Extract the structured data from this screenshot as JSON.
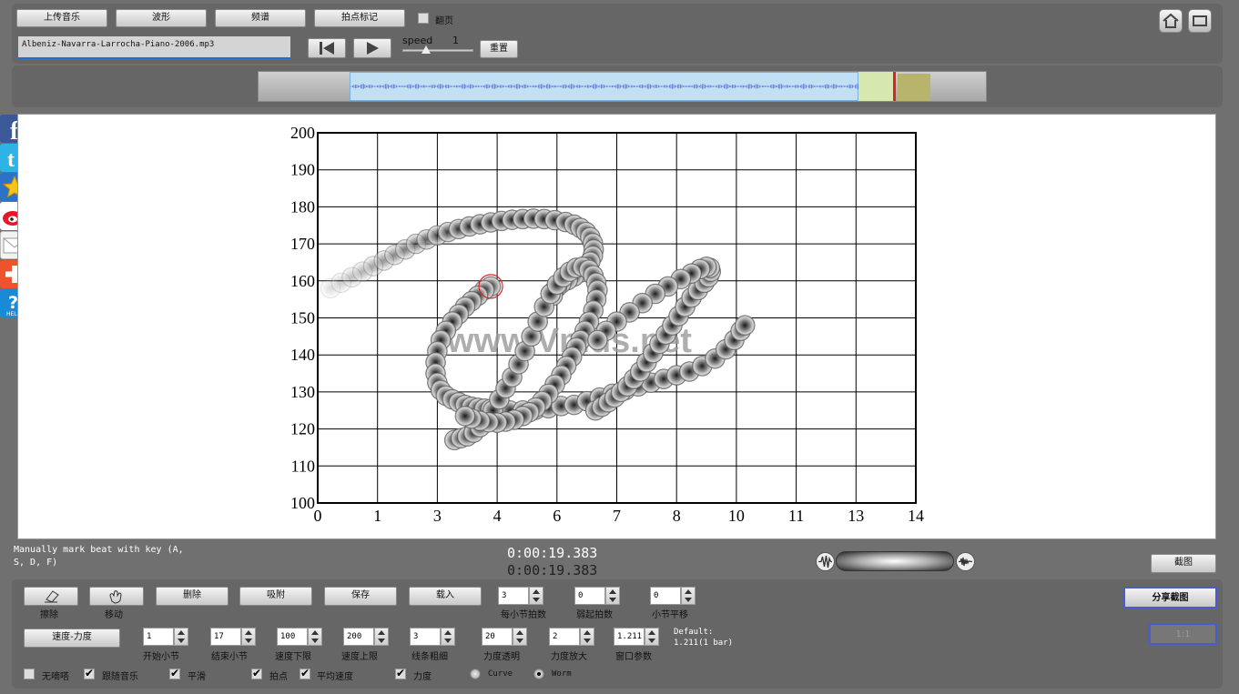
{
  "toolbar": {
    "upload_label": "上传音乐",
    "waveform_label": "波形",
    "spectrum_label": "频谱",
    "beat_mark_label": "拍点标记",
    "flip_label": "翻页",
    "flip_checked": false,
    "filename": "Albeniz-Navarra-Larrocha-Piano-2006.mp3",
    "speed_label": "speed",
    "speed_value": "1",
    "speed_fraction": 0.32,
    "reset_label": "重置"
  },
  "timeline": {
    "view_start_fraction": 0.125,
    "view_end_fraction": 0.825,
    "playhead_fraction": 0.873
  },
  "chart_data": {
    "type": "scatter",
    "title": "",
    "xlabel": "",
    "ylabel": "",
    "xlim": [
      0,
      14
    ],
    "ylim": [
      100,
      200
    ],
    "x_ticks": [
      0,
      1,
      3,
      4,
      6,
      7,
      8,
      10,
      11,
      13,
      14
    ],
    "y_ticks": [
      100,
      110,
      120,
      130,
      140,
      150,
      160,
      170,
      180,
      190,
      200
    ],
    "grid": true,
    "watermark": "www.Vmus.net",
    "highlighted_point": [
      4.05,
      158.5
    ],
    "points": [
      [
        0.3,
        158
      ],
      [
        0.55,
        159.5
      ],
      [
        0.8,
        161
      ],
      [
        1.05,
        162.5
      ],
      [
        1.3,
        164
      ],
      [
        1.55,
        165.5
      ],
      [
        1.8,
        167
      ],
      [
        2.05,
        168.5
      ],
      [
        2.3,
        170
      ],
      [
        2.55,
        171.2
      ],
      [
        2.8,
        172.3
      ],
      [
        3.05,
        173.2
      ],
      [
        3.3,
        174
      ],
      [
        3.55,
        174.7
      ],
      [
        3.8,
        175.3
      ],
      [
        4.05,
        175.8
      ],
      [
        4.3,
        176.2
      ],
      [
        4.55,
        176.5
      ],
      [
        4.8,
        176.7
      ],
      [
        5.05,
        176.8
      ],
      [
        5.3,
        176.7
      ],
      [
        5.55,
        176.4
      ],
      [
        5.8,
        175.9
      ],
      [
        6.0,
        175.2
      ],
      [
        6.15,
        174.3
      ],
      [
        6.28,
        173.2
      ],
      [
        6.38,
        171.8
      ],
      [
        6.44,
        170.2
      ],
      [
        6.46,
        168.5
      ],
      [
        6.44,
        166.8
      ],
      [
        6.38,
        165.2
      ],
      [
        6.28,
        163.7
      ],
      [
        6.16,
        162.3
      ],
      [
        6.0,
        161.2
      ],
      [
        5.85,
        160.2
      ],
      [
        5.7,
        159.3
      ],
      [
        5.6,
        158.3
      ],
      [
        5.52,
        157.2
      ],
      [
        5.5,
        156
      ],
      [
        4.05,
        158.5
      ],
      [
        3.9,
        157.5
      ],
      [
        3.75,
        156
      ],
      [
        3.6,
        154.5
      ],
      [
        3.45,
        153
      ],
      [
        3.3,
        151
      ],
      [
        3.15,
        149
      ],
      [
        3.0,
        146.5
      ],
      [
        2.88,
        144
      ],
      [
        2.8,
        141
      ],
      [
        2.76,
        138
      ],
      [
        2.76,
        135
      ],
      [
        2.8,
        132.5
      ],
      [
        2.88,
        130.5
      ],
      [
        3.0,
        129
      ],
      [
        3.15,
        128
      ],
      [
        3.3,
        127.2
      ],
      [
        3.45,
        126.5
      ],
      [
        3.6,
        126
      ],
      [
        3.75,
        125.7
      ],
      [
        3.9,
        125.5
      ],
      [
        4.05,
        125.4
      ],
      [
        4.2,
        125.2
      ],
      [
        4.5,
        125
      ],
      [
        4.8,
        125
      ],
      [
        5.1,
        125.2
      ],
      [
        5.4,
        125.6
      ],
      [
        5.7,
        126.2
      ],
      [
        3.2,
        117
      ],
      [
        3.35,
        117.5
      ],
      [
        3.5,
        118
      ],
      [
        3.65,
        119
      ],
      [
        3.8,
        120.5
      ],
      [
        3.95,
        122.5
      ],
      [
        4.1,
        125
      ],
      [
        4.25,
        128
      ],
      [
        4.4,
        131
      ],
      [
        4.55,
        134
      ],
      [
        4.7,
        137.5
      ],
      [
        4.85,
        141
      ],
      [
        5.0,
        145
      ],
      [
        5.15,
        149
      ],
      [
        5.3,
        153
      ],
      [
        5.45,
        156.5
      ],
      [
        5.6,
        159
      ],
      [
        5.75,
        161
      ],
      [
        5.9,
        162.5
      ],
      [
        6.05,
        163.5
      ],
      [
        6.2,
        163.8
      ],
      [
        6.35,
        163
      ],
      [
        6.45,
        161.5
      ],
      [
        6.52,
        159.5
      ],
      [
        6.55,
        157.5
      ],
      [
        6.52,
        155
      ],
      [
        6.45,
        152
      ],
      [
        6.35,
        149
      ],
      [
        6.25,
        146.5
      ],
      [
        6.15,
        144
      ],
      [
        6.05,
        142
      ],
      [
        5.95,
        139.5
      ],
      [
        5.82,
        137
      ],
      [
        5.7,
        134.5
      ],
      [
        5.55,
        132
      ],
      [
        5.4,
        129.5
      ],
      [
        5.25,
        127.5
      ],
      [
        5.1,
        125.8
      ],
      [
        4.95,
        124.5
      ],
      [
        4.8,
        123.5
      ],
      [
        4.6,
        122.5
      ],
      [
        4.4,
        122
      ],
      [
        4.2,
        121.7
      ],
      [
        4.0,
        121.8
      ],
      [
        3.8,
        122.2
      ],
      [
        3.6,
        122.8
      ],
      [
        3.45,
        123.5
      ],
      [
        6.0,
        126.5
      ],
      [
        6.3,
        127.5
      ],
      [
        6.6,
        128.5
      ],
      [
        6.9,
        129.5
      ],
      [
        7.2,
        130.5
      ],
      [
        7.5,
        131.5
      ],
      [
        7.8,
        132.5
      ],
      [
        8.1,
        133.5
      ],
      [
        8.4,
        134.5
      ],
      [
        8.7,
        135.5
      ],
      [
        9.0,
        137
      ],
      [
        9.3,
        139
      ],
      [
        9.55,
        141.5
      ],
      [
        9.75,
        144
      ],
      [
        9.9,
        146.5
      ],
      [
        10.0,
        148
      ],
      [
        6.5,
        125
      ],
      [
        6.65,
        126
      ],
      [
        6.8,
        127.2
      ],
      [
        6.95,
        128.5
      ],
      [
        7.1,
        130
      ],
      [
        7.25,
        131.5
      ],
      [
        7.4,
        133.5
      ],
      [
        7.55,
        135.5
      ],
      [
        7.7,
        138
      ],
      [
        7.85,
        140.5
      ],
      [
        8.0,
        143
      ],
      [
        8.15,
        145.5
      ],
      [
        8.3,
        148
      ],
      [
        8.45,
        150.5
      ],
      [
        8.6,
        153
      ],
      [
        8.75,
        155.5
      ],
      [
        8.9,
        157.5
      ],
      [
        9.05,
        159.5
      ],
      [
        9.15,
        161
      ],
      [
        9.2,
        162.5
      ],
      [
        9.18,
        163.5
      ],
      [
        9.1,
        163.8
      ],
      [
        8.95,
        163.2
      ],
      [
        8.75,
        162
      ],
      [
        8.5,
        160.5
      ],
      [
        8.2,
        158.5
      ],
      [
        7.9,
        156.5
      ],
      [
        7.6,
        154
      ],
      [
        7.3,
        151.5
      ],
      [
        7.0,
        149
      ],
      [
        6.75,
        146.5
      ],
      [
        6.55,
        144
      ]
    ]
  },
  "status": {
    "hint": "Manually mark beat with key (A, S, D, F)",
    "time_1": "0:00:19.383",
    "time_2": "0:00:19.383",
    "screenshot_label": "截图"
  },
  "bottom": {
    "erase_label": "擦除",
    "move_label": "移动",
    "delete_label": "删除",
    "snap_label": "吸附",
    "save_label": "保存",
    "load_label": "载入",
    "beats_per_bar": {
      "value": "3",
      "label": "每小节拍数"
    },
    "pickup_beats": {
      "value": "0",
      "label": "弱起拍数"
    },
    "bar_offset": {
      "value": "0",
      "label": "小节平移"
    },
    "share_label": "分享截图",
    "mode_label": "速度-力度",
    "start_bar": {
      "value": "1",
      "label": "开始小节"
    },
    "end_bar": {
      "value": "17",
      "label": "结束小节"
    },
    "tempo_min": {
      "value": "100",
      "label": "速度下限"
    },
    "tempo_max": {
      "value": "200",
      "label": "速度上限"
    },
    "line_width": {
      "value": "3",
      "label": "线条粗细"
    },
    "dynamic_transparency": {
      "value": "20",
      "label": "力度透明"
    },
    "dynamic_scale": {
      "value": "2",
      "label": "力度放大"
    },
    "window_param": {
      "value": "1.211",
      "label": "窗口参数"
    },
    "default_label": "Default:",
    "default_value": "1.211(1 bar)",
    "ratio_label": "1:1",
    "checks": [
      {
        "label": "无嘀嗒",
        "checked": false
      },
      {
        "label": "跟随音乐",
        "checked": true
      },
      {
        "label": "平滑",
        "checked": true
      },
      {
        "label": "拍点",
        "checked": true
      },
      {
        "label": "平均速度",
        "checked": true
      },
      {
        "label": "力度",
        "checked": true
      }
    ],
    "radios": [
      {
        "label": "Curve",
        "selected": false
      },
      {
        "label": "Worm",
        "selected": true
      }
    ]
  }
}
